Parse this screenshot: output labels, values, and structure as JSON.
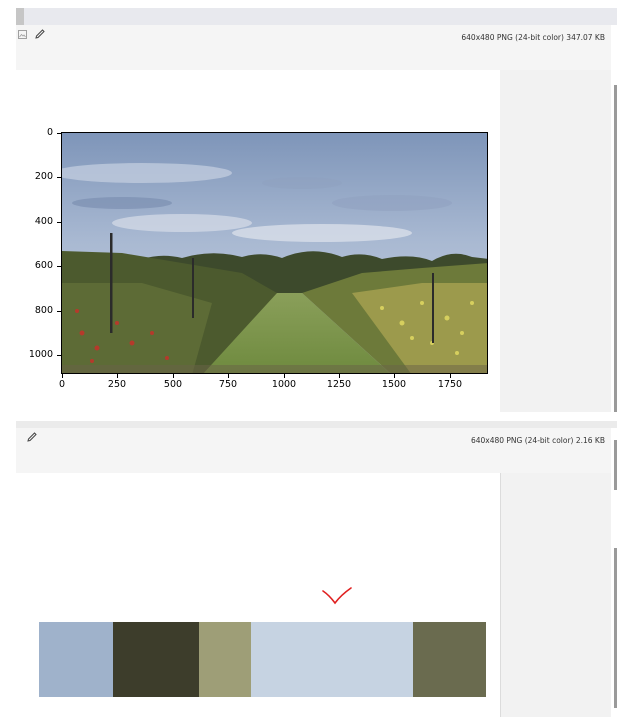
{
  "viewer_top": {
    "info": "640x480 PNG (24-bit color) 347.07 KB",
    "icons": [
      "image-icon",
      "eyedropper-icon"
    ],
    "plot": {
      "yticks": [
        "0",
        "200",
        "400",
        "600",
        "800",
        "1000"
      ],
      "xticks": [
        "0",
        "250",
        "500",
        "750",
        "1000",
        "1250",
        "1500",
        "1750"
      ],
      "image": "apple-orchard-photo"
    }
  },
  "viewer_bottom": {
    "info": "640x480 PNG (24-bit color) 2.16 KB",
    "icons": [
      "eyedropper-icon"
    ],
    "palette": {
      "colors": [
        "#9fb2cb",
        "#3d3d2b",
        "#9e9e77",
        "#c6d3e2",
        "#6a6b4f"
      ],
      "fractions": [
        0.166,
        0.193,
        0.116,
        0.361,
        0.164
      ]
    }
  },
  "annotation": {
    "mark": "checkmark",
    "color": "#e02020"
  }
}
